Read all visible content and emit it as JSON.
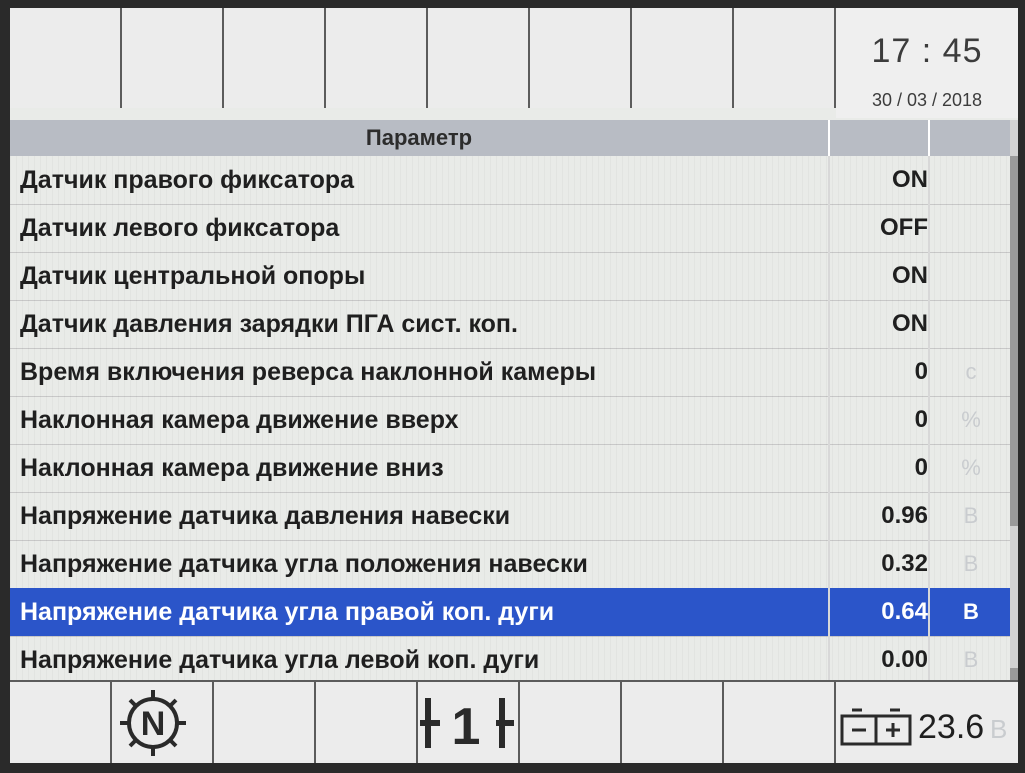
{
  "clock": {
    "time": "17 : 45",
    "date": "30 / 03 / 2018"
  },
  "table": {
    "header": "Параметр",
    "rows": [
      {
        "label": "Датчик правого фиксатора",
        "value": "ON",
        "unit": ""
      },
      {
        "label": "Датчик левого фиксатора",
        "value": "OFF",
        "unit": ""
      },
      {
        "label": "Датчик центральной опоры",
        "value": "ON",
        "unit": ""
      },
      {
        "label": "Датчик давления зарядки ПГА сист. коп.",
        "value": "ON",
        "unit": ""
      },
      {
        "label": "Время включения реверса наклонной камеры",
        "value": "0",
        "unit": "с"
      },
      {
        "label": "Наклонная камера движение вверх",
        "value": "0",
        "unit": "%"
      },
      {
        "label": "Наклонная камера движение вниз",
        "value": "0",
        "unit": "%"
      },
      {
        "label": "Напряжение датчика давления навески",
        "value": "0.96",
        "unit": "В"
      },
      {
        "label": "Напряжение датчика угла положения навески",
        "value": "0.32",
        "unit": "В"
      },
      {
        "label": "Напряжение датчика угла правой коп. дуги",
        "value": "0.64",
        "unit": "В",
        "selected": true
      },
      {
        "label": "Напряжение датчика угла левой коп. дуги",
        "value": "0.00",
        "unit": "В"
      }
    ],
    "selected_color": "#2b55c9"
  },
  "bottombar": {
    "gear_mode": "N",
    "range_label": "1",
    "battery_value": "23.6",
    "battery_unit": "В",
    "icons": [
      "neutral-gear-icon",
      "transmission-range-icon",
      "battery-icon"
    ]
  }
}
